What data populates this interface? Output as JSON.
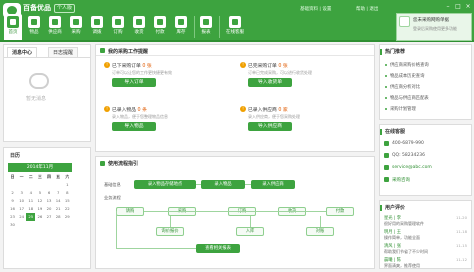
{
  "app": {
    "brand": "百备优品",
    "edition": "个人版",
    "accent": "#3da33f"
  },
  "top_links": {
    "user": "帮助 | 退出",
    "center": "基础资料 | 设置"
  },
  "nav": [
    {
      "label": "首页",
      "icon": "home-icon"
    },
    {
      "label": "物品",
      "icon": "goods-icon"
    },
    {
      "label": "供应商",
      "icon": "supplier-icon"
    },
    {
      "label": "采购",
      "icon": "purchase-icon"
    },
    {
      "label": "调拨",
      "icon": "transfer-icon"
    },
    {
      "label": "订购",
      "icon": "order-icon"
    },
    {
      "label": "收货",
      "icon": "receive-icon"
    },
    {
      "label": "付款",
      "icon": "payment-icon"
    },
    {
      "label": "库存",
      "icon": "stock-icon"
    },
    {
      "label": "报表",
      "icon": "report-icon"
    },
    {
      "label": "在线客服",
      "icon": "chat-icon"
    }
  ],
  "user_box": {
    "line1": "您未采购网购单据",
    "line2": "登录后采购使用更多功能"
  },
  "left": {
    "tab_message": "消息中心",
    "tab_log": "日志提醒",
    "empty": "暂无消息",
    "calendar_title": "日历",
    "calendar_month": "2014年11月",
    "week": [
      "日",
      "一",
      "二",
      "三",
      "四",
      "五",
      "六"
    ],
    "days": [
      [
        "",
        "",
        "",
        "",
        "",
        "",
        "1"
      ],
      [
        "2",
        "3",
        "4",
        "5",
        "6",
        "7",
        "8"
      ],
      [
        "9",
        "10",
        "11",
        "12",
        "13",
        "14",
        "15"
      ],
      [
        "16",
        "17",
        "18",
        "19",
        "20",
        "21",
        "22"
      ],
      [
        "23",
        "24",
        "25",
        "26",
        "27",
        "28",
        "29"
      ],
      [
        "30",
        "",
        "",
        "",
        "",
        "",
        ""
      ]
    ],
    "today": "25"
  },
  "tasks": {
    "title": "我的采购工作提醒",
    "items": [
      {
        "title": "已下采购订单",
        "count": "0 张",
        "sub": "订单可以让您的工作更快捷更有效",
        "button": "导入订单"
      },
      {
        "title": "已完采购订单",
        "count": "0 张",
        "sub": "订单已完成采购，可以进行收货处理",
        "button": "导入收货单"
      },
      {
        "title": "已录入物品",
        "count": "0 条",
        "sub": "录入物品，便于您整理物品信息",
        "button": "导入物品"
      },
      {
        "title": "已录入供应商",
        "count": "0 家",
        "sub": "录入供应商，便于您采购处理",
        "button": "导入供应商"
      }
    ]
  },
  "flow": {
    "title": "使用流程指引",
    "row1_label": "基础信息",
    "row2_label": "业务流程",
    "row1": [
      "录入物品存储地点",
      "录入物品",
      "录入供应商"
    ],
    "row2": [
      "请购",
      "采购",
      "订购",
      "收货",
      "付款"
    ],
    "row3": [
      "询价报价",
      "入库",
      "对账"
    ],
    "row4": "查看相关报表"
  },
  "right": {
    "hot_title": "热门推荐",
    "hot_links": [
      "供应商采购价格查询",
      "物品成本历史查询",
      "供应商分析对比",
      "物品与供应商匹配表",
      "采购计划管理"
    ],
    "contact_title": "在线客服",
    "phone": "400-6879-990",
    "qq": "QQ: 58234236",
    "email": "service@abc.com",
    "online": "采购咨询",
    "comments_title": "用户评价",
    "comments": [
      {
        "name": "星光 | 李",
        "text": "很好用的采购管理软件",
        "date": "11-20"
      },
      {
        "name": "明月 | 王",
        "text": "操作简单，功能全面",
        "date": "11-18"
      },
      {
        "name": "清风 | 张",
        "text": "帮助我们节省了不少时间",
        "date": "11-15"
      },
      {
        "name": "晨曦 | 陈",
        "text": "界面清爽，推荐使用",
        "date": "11-12"
      }
    ]
  }
}
